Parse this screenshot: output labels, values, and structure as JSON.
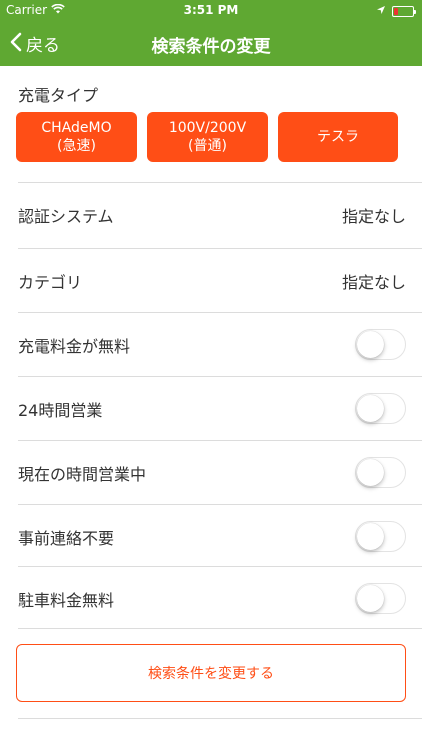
{
  "status": {
    "carrier": "Carrier",
    "time": "3:51 PM"
  },
  "nav": {
    "back_label": "戻る",
    "title": "検索条件の変更"
  },
  "charge_type": {
    "label": "充電タイプ",
    "buttons": [
      {
        "line1": "CHAdeMO",
        "line2": "(急速)"
      },
      {
        "line1": "100V/200V",
        "line2": "(普通)"
      },
      {
        "line1": "テスラ",
        "line2": ""
      }
    ]
  },
  "settings": [
    {
      "label": "認証システム",
      "value": "指定なし"
    },
    {
      "label": "カテゴリ",
      "value": "指定なし"
    }
  ],
  "toggles": [
    {
      "label": "充電料金が無料",
      "on": false
    },
    {
      "label": "24時間営業",
      "on": false
    },
    {
      "label": "現在の時間営業中",
      "on": false
    },
    {
      "label": "事前連絡不要",
      "on": false
    },
    {
      "label": "駐車料金無料",
      "on": false
    }
  ],
  "submit_label": "検索条件を変更する",
  "colors": {
    "nav_green": "#5fa832",
    "accent_orange": "#ff4e16"
  }
}
